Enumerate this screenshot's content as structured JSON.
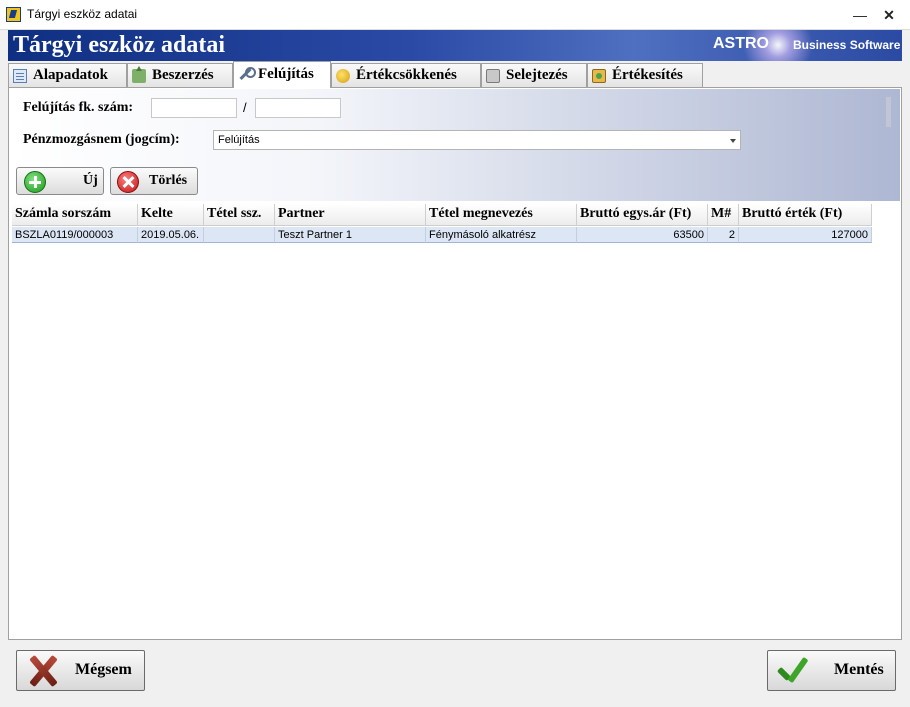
{
  "window": {
    "title": "Tárgyi eszköz adatai",
    "minimize_glyph": "—",
    "close_glyph": "✕"
  },
  "banner": {
    "title": "Tárgyi eszköz adatai",
    "brand_name": "ASTRO",
    "brand_subtitle": "Business Software"
  },
  "tabs": [
    {
      "label": "Alapadatok",
      "icon": "list-icon",
      "active": false
    },
    {
      "label": "Beszerzés",
      "icon": "purchase-icon",
      "active": false
    },
    {
      "label": "Felújítás",
      "icon": "wrench-icon",
      "active": true
    },
    {
      "label": "Értékcsökkenés",
      "icon": "coins-icon",
      "active": false
    },
    {
      "label": "Selejtezés",
      "icon": "trash-icon",
      "active": false
    },
    {
      "label": "Értékesítés",
      "icon": "sale-icon",
      "active": false
    }
  ],
  "form": {
    "ledger_label": "Felújítás fk. szám:",
    "ledger_value_1": "",
    "ledger_separator": "/",
    "ledger_value_2": "",
    "payment_type_label": "Pénzmozgásnem (jogcím):",
    "payment_type_value": "Felújítás"
  },
  "actions": {
    "new_label": "Új",
    "delete_label": "Törlés"
  },
  "table": {
    "columns": [
      "Számla sorszám",
      "Kelte",
      "Tétel ssz.",
      "Partner",
      "Tétel megnevezés",
      "Bruttó egys.ár (Ft)",
      "M#",
      "Bruttó érték (Ft)"
    ],
    "rows": [
      [
        "BSZLA0119/000003",
        "2019.05.06.",
        "",
        "Teszt Partner 1",
        "Fénymásoló alkatrész",
        "63500",
        "2",
        "127000"
      ]
    ]
  },
  "footer": {
    "cancel_label": "Mégsem",
    "save_label": "Mentés"
  },
  "colors": {
    "banner_dark": "#0f2f82",
    "row_selected": "#dde6f5"
  }
}
